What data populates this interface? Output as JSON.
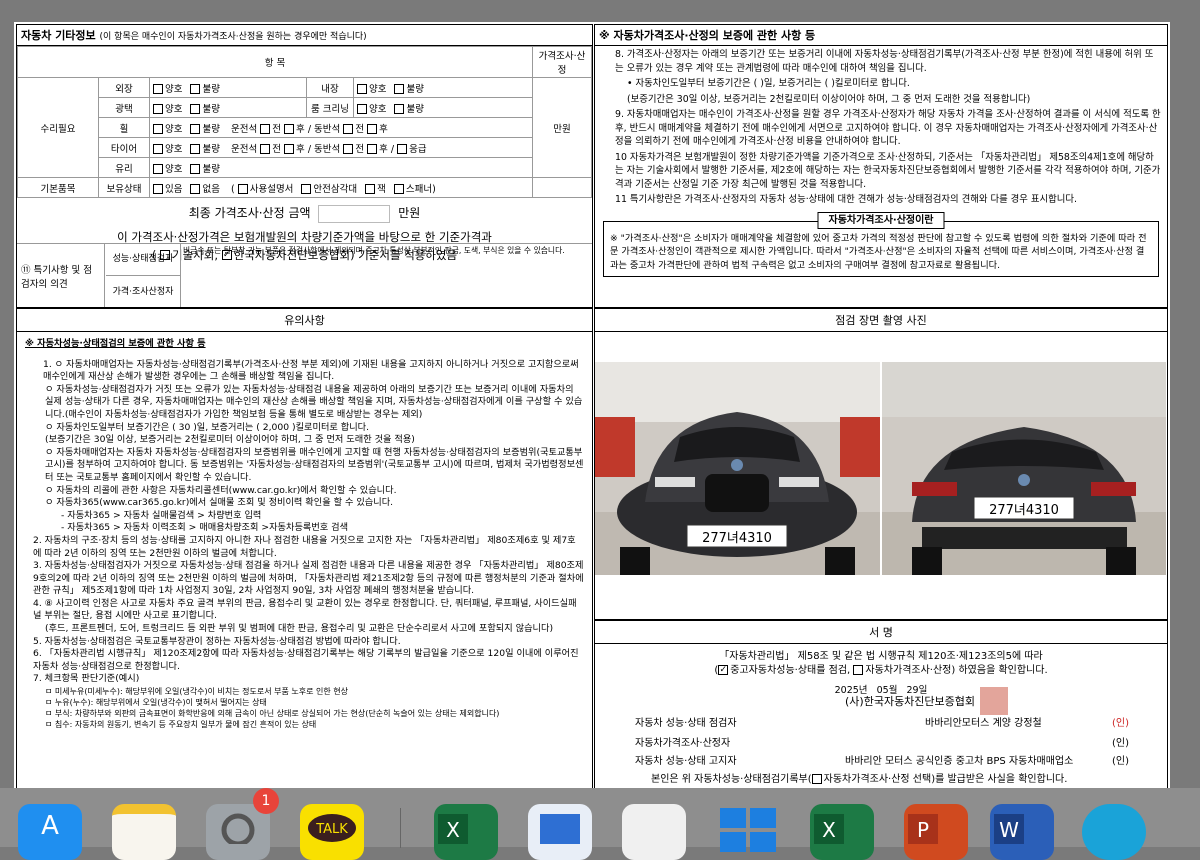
{
  "left_info": {
    "title": "자동차 기타정보",
    "subtitle": "(이 항목은 매수인이 자동차가격조사·산정을 원하는 경우에만 적습니다)",
    "col_item": "항      목",
    "col_price": "가격조사·산정",
    "repair_label": "수리필요",
    "labels": {
      "exterior": "외장",
      "interior": "내장",
      "gloss": "광택",
      "room_clean": "룸 크리닝",
      "wheel": "휠",
      "tire": "타이어",
      "glass": "유리",
      "driver": "운전석",
      "passenger": "동반석",
      "front": "전",
      "rear": "후",
      "emergency": "응급",
      "good": "양호",
      "bad": "불량"
    },
    "price_value": "만원",
    "basic_label": "기본품목",
    "possession": "보유상태",
    "have": "있음",
    "none": "없음",
    "manual": "사용설명서",
    "triangle": "안전삼각대",
    "jack": "잭",
    "spanner": "스패너",
    "final_price_label": "최종 가격조사·산정 금액",
    "final_price_unit": "만원",
    "basis_text": "이 가격조사·산정가격은 보험개발원의 차량기준가액을 바탕으로 한 기준가격과",
    "basis_options_pre": "(",
    "basis_opt1": "기술사회,",
    "basis_opt2": "한국자동차진단보증협회)",
    "basis_tail": "기준서를 적용하였음",
    "special_label": "⑪ 특기사항 및 점검자의 의견",
    "perf_inspector": "성능·상태점검자",
    "perf_note": "비금속 또는 탈부착 가능 부품은 점검사항에서 제외되며 중고차 특성상 부분적인 판금, 도색, 부식은 있을 수 있습니다.",
    "price_inspector": "가격·조사산정자"
  },
  "right_top": {
    "title": "※ 자동차가격조사·산정의 보증에 관한 사항 등",
    "item8": "8. 가격조사·산정자는 아래의 보증기간 또는 보증거리 이내에 자동차성능·상태점검기록부(가격조사·산정 부분 한정)에 적힌 내용에 허위 또는 오류가 있는 경우 계약 또는 관계법령에 따라 매수인에 대하여 책임을 집니다.",
    "item8_sub1": "• 자동차인도일부터 보증기간은 (      )일, 보증거리는 (       )킬로미터로 합니다.",
    "item8_sub2": "(보증기간은 30일 이상, 보증거리는 2천킬로미터 이상이어야 하며, 그 중 먼저 도래한 것을 적용합니다)",
    "item9": "9. 자동차매매업자는 매수인이 가격조사·산정을 원할 경우 가격조사·산정자가 해당 자동차 가격을 조사·산정하여 결과를 이 서식에 적도록 한 후, 반드시 매매계약을 체결하기 전에 매수인에게 서면으로 고지하여야 합니다. 이 경우 자동차매매업자는 가격조사·산정자에게 가격조사·산정을 의뢰하기 전에 매수인에게 가격조사·산정 비용을 안내하여야 합니다.",
    "item10": "10 자동차가격은 보험개발원이 정한 차량기준가액을 기준가격으로 조사·산정하되, 기준서는 「자동차관리법」 제58조의4제1호에 해당하는 자는 기술사회에서 발행한 기준서를, 제2호에 해당하는 자는 한국자동차진단보증협회에서 발행한 기준서를 각각 적용하여야 하며, 기준가격과 기준서는 산정일 기준 가장 최근에 발행된 것을 적용합니다.",
    "item11": "11 특기사항란은 가격조사·산정자의 자동차 성능·상태에 대한 견해가 성능·상태점검자의 견해와 다를 경우 표시합니다.",
    "box_title": "자동차가격조사·산정이란",
    "box_text": "※ \"가격조사·산정\"은 소비자가 매매계약을 체결함에 있어 중고차 가격의 적정성 판단에 참고할 수 있도록 법령에 의한 절차와 기준에 따라 전문 가격조사·산정인이 객관적으로 제시한 가액입니다. 따라서 \"가격조사·산정\"은 소비자의 자율적 선택에 따른 서비스이며, 가격조사·산정 결과는 중고차 가격판단에 관하여 법적 구속력은 없고 소비자의 구매여부 결정에 참고자료로 활용됩니다."
  },
  "notes": {
    "header": "유의사항",
    "title": "※ 자동차성능·상태점검의 보증에 관한 사항 등",
    "n1a": "1.  ㅇ 자동차매매업자는 자동차성능·상태점검기록부(가격조사·산정 부분 제외)에 기재된 내용을 고지하지 아니하거나 거짓으로 고지함으로써 매수인에게 재산상 손해가 발생한 경우에는 그 손해를 배상할 책임을 집니다.",
    "n1b": "ㅇ 자동차성능·상태점검자가 거짓 또는 오류가 있는 자동차성능·상태점검 내용을 제공하여 아래의 보증기간 또는 보증거리 이내에 자동차의 실제 성능·상태가 다른 경우, 자동차매매업자는 매수인의 재산상 손해를 배상할 책임을 지며, 자동차성능·상태점검자에게 이를 구상할 수 있습니다.(매수인이 자동차성능·상태점검자가 가입한 책임보험 등을 통해 별도로 배상받는 경우는 제외)",
    "n1c": "ㅇ 자동차인도일부터 보증기간은 (  30  )일, 보증거리는 (  2,000  )킬로미터로 합니다.",
    "n1d": "(보증기간은 30일 이상, 보증거리는 2천킬로미터 이상이어야 하며, 그 중 먼저 도래한 것을  적용)",
    "n1e": "ㅇ 자동차매매업자는 자동차 자동차성능·상태점검자의 보증범위를 매수인에게 고지할 때 현행 자동차성능·상태점검자의 보증범위(국토교통부 고시)를 청부하여 고지하여야 합니다. 동 보증범위는 '자동차성능·상태점검자의 보증범위'(국토교통부 고시)에 따르며, 법제처 국가법령정보센터 또는 국토교통부 홈페이지에서 확인할 수 있습니다.",
    "n1f": "ㅇ 자동차의 리콜에 관한 사항은 자동차리콜센터(www.car.go.kr)에서 확인할 수 있습니다.",
    "n1g": "ㅇ 자동차365(www.car365.go.kr)에서 실매물 조회 및 정비이력 확인을 할 수 있습니다.",
    "n1h": "- 자동차365 > 자동차 실매물검색 > 차량번호 입력",
    "n1i": "- 자동차365 > 자동차 이력조회 > 매매용차량조회 >자동차등록번호 검색",
    "n2": "2. 자동차의 구조·장치 등의 성능·상태를 고지하지 아니한 자나 점검한 내용을 거짓으로 고지한 자는 「자동차관리법」 제80조제6호 및 제7호에 따라 2년 이하의 징역 또는 2천만원 이하의 벌금에 처합니다.",
    "n3": "3. 자동차성능·상태점검자가 거짓으로 자동차성능·상태 점검을 하거나 실제 점검한 내용과 다른 내용을 제공한 경우 「자동차관리법」 제80조제9호의2에 따라 2년 이하의 징역 또는 2천만원 이하의 벌금에 처하며, 「자동차관리법 제21조제2항 등의 규정에 따른 행정처분의 기준과 절차에 관한 규칙」 제5조제1항에 따라 1차 사업정지 30일, 2차 사업정지 90일, 3차 사업장 폐쇄의 행정처분을 받습니다.",
    "n4a": "4. ⑧ 사고이력 인정은 사고로 자동차 주요 골격 부위의 판금, 용접수리 및 교환이 있는 경우로 한정합니다. 단, 쿼터패널, 루프패널, 사이드실패널 부위는 절단, 용접 시에만 사고로 표기합니다.",
    "n4b": "(후드, 프론트펜더, 도어, 트렁크리드 등 외판 부위 및 범퍼에 대한 판금, 용접수리 및 교환은 단순수리로서 사고에 포함되지 않습니다)",
    "n5": "5. 자동차성능·상태점검은 국토교통부장관이 정하는 자동차성능·상태점검 방법에 따라야 합니다.",
    "n6": "6. 「자동차관리법 시행규칙」 제120조제2항에 따라 자동차성능·상태점검기록부는 해당 기록부의 발급일을 기준으로 120일 이내에 이루어진 자동차 성능·상태점검으로 한정합니다.",
    "n7": "7. 체크항목 판단기준(예시)",
    "n7a": "ㅁ 미세누유(미세누수): 해당부위에 오일(냉각수)이 비치는 정도로서 부품 노후로 인한 현상",
    "n7b": "ㅁ 누유(누수): 해당부위에서 오일(냉각수)이 맺혀서 떨어지는 상태",
    "n7c": "ㅁ 부식: 차량하부와 외판의 금속표면이 화학반응에 의해 금속이 아닌 상태로 상실되어 가는  현상(단순히 녹슬어 있는 상태는 제외합니다)",
    "n7d": "ㅁ 침수: 자동차의 원동기, 변속기 등 주요장치 일부가 물에 잠긴 흔적이 있는 상태"
  },
  "photos": {
    "header": "점검 장면 촬영 사진",
    "plate_front": "277녀4310",
    "plate_rear": "277녀4310"
  },
  "signature": {
    "header": "서      명",
    "line1": "「자동차관리법」 제58조 및 같은 법 시행규칙 제120조·제123조의5에 따라",
    "line2_a": "(",
    "line2_b": "중고자동차성능·상태를 점검,",
    "line2_c": "자동차가격조사·산정) 하였음을 확인합니다.",
    "date_year": "2025년",
    "date_month": "05월",
    "date_day": "29일",
    "org": "(사)한국자동차진단보증협회",
    "row1_label": "자동차 성능·상태 점검자",
    "row1_value": "바바리안모터스 계양 강정철",
    "row2_label": "자동차가격조사·산정자",
    "row3_label": "자동차 성능·상태 고지자",
    "row3_value": "바바리안 모터스 공식인증 중고차 BPS 자동차매매업소",
    "seal": "(인)",
    "last_line_a": "본인은 위 자동차성능·상태점검기록부(",
    "last_line_b": "자동차가격조사·산정 선택)를 발급받은 사실을 확인합니다."
  },
  "dock": {
    "badge": "1",
    "talk": "TALK",
    "excel_letter": "X",
    "ppt_letter": "P",
    "word_letter": "W"
  }
}
